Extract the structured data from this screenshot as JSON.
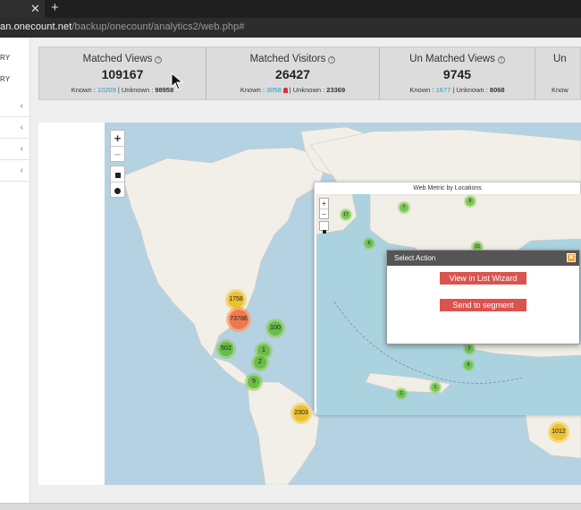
{
  "browser": {
    "tab_close_glyph": "✕",
    "new_tab_glyph": "+",
    "url_host": "an.onecount.net",
    "url_path": "/backup/onecount/analytics2/web.php#"
  },
  "sidebar": {
    "labels": [
      "RY",
      "RY"
    ],
    "chevron_glyph": "‹"
  },
  "stats": [
    {
      "title": "Matched Views",
      "value": "109167",
      "known_label": "Known :",
      "known": "10209",
      "unknown_label": "| Unknown :",
      "unknown": "98958"
    },
    {
      "title": "Matched Visitors",
      "value": "26427",
      "known_label": "Known :",
      "known": "3058",
      "unknown_label": "| Unknown :",
      "unknown": "23369"
    },
    {
      "title": "Un Matched Views",
      "value": "9745",
      "known_label": "Known :",
      "known": "1677",
      "unknown_label": "| Unknown :",
      "unknown": "8068"
    },
    {
      "title": "Un",
      "value": "",
      "known_label": "Know",
      "known": "",
      "unknown_label": "",
      "unknown": ""
    }
  ],
  "help_glyph": "?",
  "map": {
    "zoom_in": "+",
    "zoom_out": "−",
    "clusters": [
      "1758",
      "73786",
      "100",
      "502",
      "1",
      "2",
      "9",
      "2303",
      "1012"
    ]
  },
  "inner_window": {
    "title": "Web Metric by Locations",
    "zoom_in": "+",
    "zoom_out": "−",
    "clusters": [
      "17",
      "7",
      "8",
      "6",
      "15",
      "2",
      "8",
      "2",
      "1"
    ]
  },
  "dialog": {
    "title": "Select Action",
    "close_glyph": "✕",
    "view_button": "View in List Wizard",
    "segment_button": "Send to segment"
  },
  "colors": {
    "water": "#b5d2e3",
    "land": "#f2efe9",
    "accent_button": "#d9534f",
    "known_value": "#1f9bd1"
  }
}
